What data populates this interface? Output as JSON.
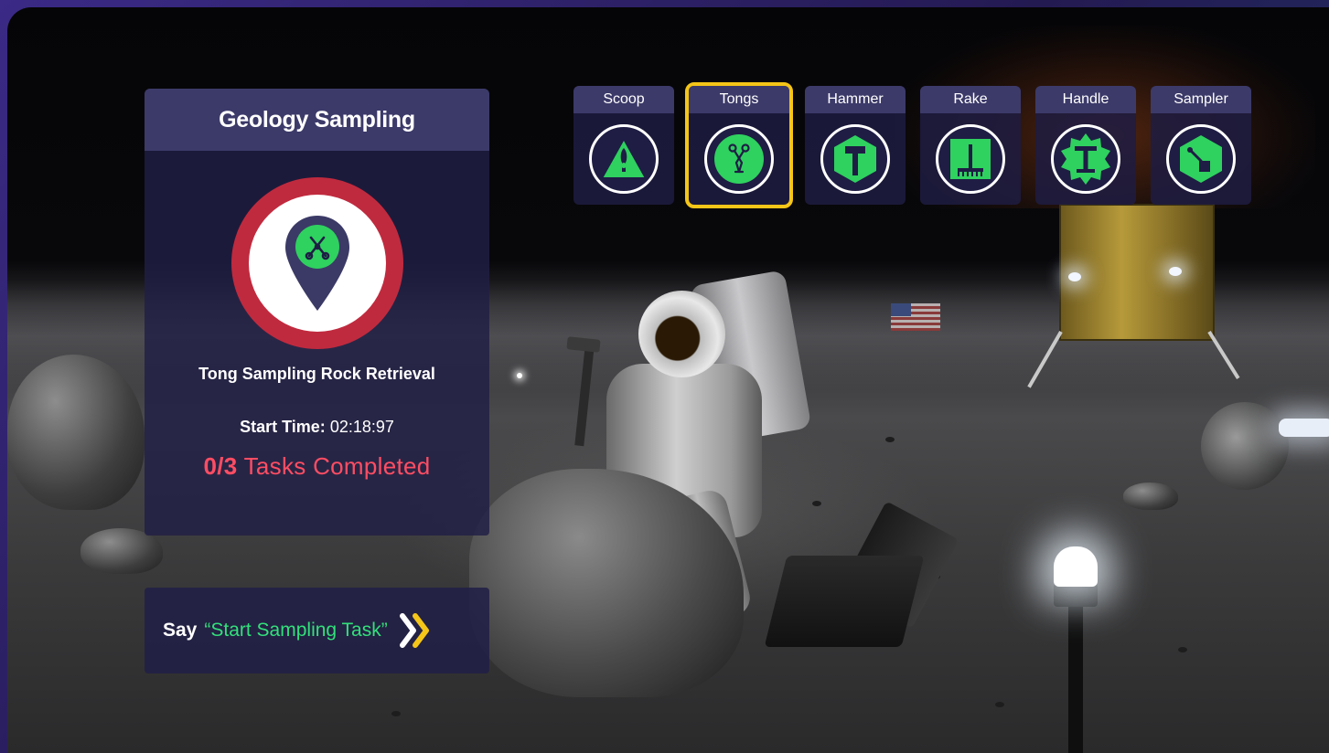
{
  "panel": {
    "title": "Geology Sampling",
    "task_name": "Tong Sampling Rock Retrieval",
    "start_time_label": "Start Time:",
    "start_time_value": "02:18:97",
    "progress_count": "0/3",
    "progress_label": "Tasks Completed"
  },
  "voice": {
    "say_label": "Say",
    "command": "“Start Sampling Task”"
  },
  "tools": [
    {
      "label": "Scoop",
      "icon": "scoop-icon"
    },
    {
      "label": "Tongs",
      "icon": "tongs-icon",
      "selected": true
    },
    {
      "label": "Hammer",
      "icon": "hammer-icon"
    },
    {
      "label": "Rake",
      "icon": "rake-icon"
    },
    {
      "label": "Handle",
      "icon": "handle-icon"
    },
    {
      "label": "Sampler",
      "icon": "sampler-icon"
    }
  ],
  "colors": {
    "accent_green": "#32e07a",
    "alert_red": "#ff4d63",
    "badge_ring": "#c02a3e",
    "selection_yellow": "#f5c518",
    "panel_bg": "#211f46",
    "panel_header": "#3c3a69"
  }
}
